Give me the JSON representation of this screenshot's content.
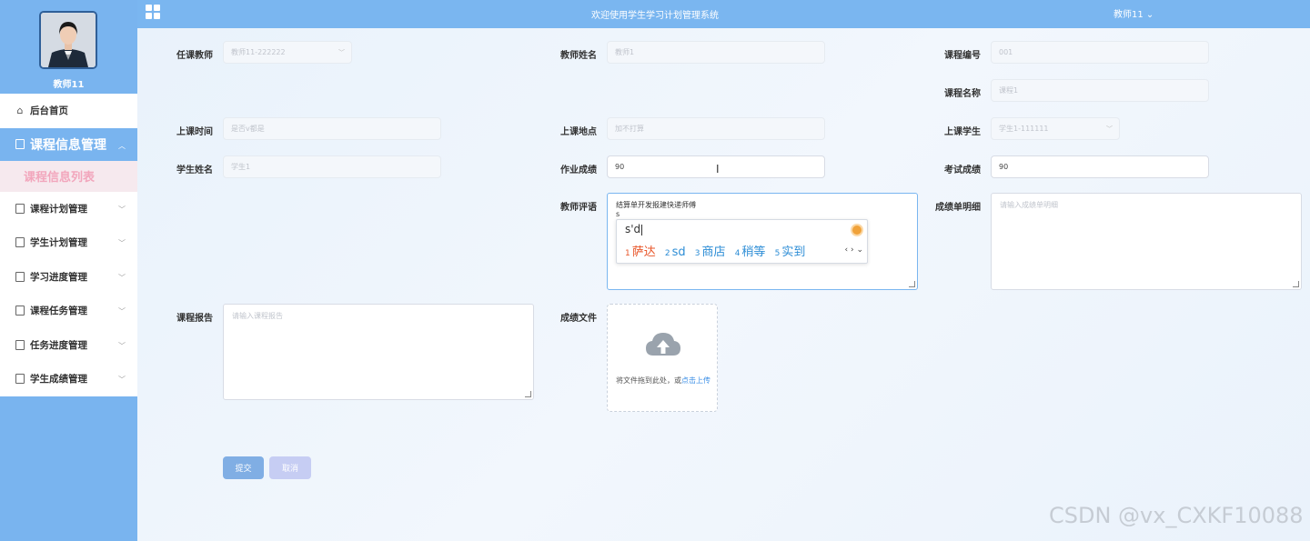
{
  "header": {
    "title": "欢迎使用学生学习计划管理系统",
    "user_menu": "教师11 ⌄"
  },
  "sidebar": {
    "username": "教师11",
    "home": "后台首页",
    "active_group": "课程信息管理",
    "active_sub": "课程信息列表",
    "items": [
      "课程计划管理",
      "学生计划管理",
      "学习进度管理",
      "课程任务管理",
      "任务进度管理",
      "学生成绩管理"
    ]
  },
  "form": {
    "teacher": {
      "label": "任课教师",
      "value": "教师11-222222"
    },
    "teacher_name": {
      "label": "教师姓名",
      "value": "教师1"
    },
    "course_no": {
      "label": "课程编号",
      "value": "001"
    },
    "course_name": {
      "label": "课程名称",
      "value": "课程1"
    },
    "class_time": {
      "label": "上课时间",
      "value": "是否v都是"
    },
    "location": {
      "label": "上课地点",
      "value": "加不打算"
    },
    "student": {
      "label": "上课学生",
      "value": "学生1-111111"
    },
    "student_name": {
      "label": "学生姓名",
      "value": "学生1"
    },
    "homework_score": {
      "label": "作业成绩",
      "value": "90"
    },
    "exam_score": {
      "label": "考试成绩",
      "value": "90"
    },
    "teacher_comment": {
      "label": "教师评语",
      "line1": "结算单开发报建快递师傅",
      "line2": "s"
    },
    "score_detail": {
      "label": "成绩单明细",
      "placeholder": "请输入成绩单明细"
    },
    "course_report": {
      "label": "课程报告",
      "placeholder": "请输入课程报告"
    },
    "score_file": {
      "label": "成绩文件",
      "hint": "将文件拖到此处，或",
      "link": "点击上传"
    },
    "submit": "提交",
    "cancel": "取消"
  },
  "ime": {
    "input": "s'd",
    "candidates": [
      {
        "num": "1",
        "text": "萨达"
      },
      {
        "num": "2",
        "text": "sd"
      },
      {
        "num": "3",
        "text": "商店"
      },
      {
        "num": "4",
        "text": "稍等"
      },
      {
        "num": "5",
        "text": "实到"
      }
    ]
  },
  "watermark": "CSDN @vx_CXKF10088"
}
